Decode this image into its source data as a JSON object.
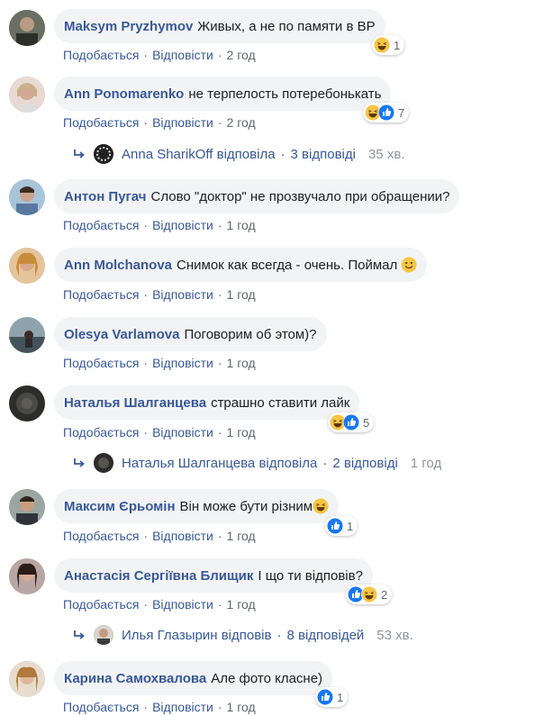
{
  "colors": {
    "link": "#385898",
    "meta": "#606770",
    "bubble": "#f2f3f5",
    "like_blue": "#1877f2",
    "haha_yellow": "#f7c444"
  },
  "comments": [
    {
      "author": "Maksym Pryzhymov",
      "text": "Живых, а не по памяти в ВР",
      "like": "Подобається",
      "reply": "Відповісти",
      "time": "2 год",
      "reactions": [
        "haha"
      ],
      "reaction_count": "1"
    },
    {
      "author": "Ann Ponomarenko",
      "text": "не терпелость потеребонькать",
      "like": "Подобається",
      "reply": "Відповісти",
      "time": "2 год",
      "reactions": [
        "haha",
        "like"
      ],
      "reaction_count": "7",
      "replies": {
        "name": "Anna SharikOff",
        "verb": "відповіла",
        "count": "3 відповіді",
        "time": "35 хв."
      }
    },
    {
      "author": "Антон Пугач",
      "text": "Слово \"доктор\" не прозвучало при обращении?",
      "like": "Подобається",
      "reply": "Відповісти",
      "time": "1 год"
    },
    {
      "author": "Ann Molchanova",
      "text": "Снимок как всегда - очень. Поймал",
      "like": "Подобається",
      "reply": "Відповісти",
      "time": "1 год",
      "inline_emoji": "smile-emoji"
    },
    {
      "author": "Olesya Varlamova",
      "text": "Поговорим об этом)?",
      "like": "Подобається",
      "reply": "Відповісти",
      "time": "1 год"
    },
    {
      "author": "Наталья Шалганцева",
      "text": "страшно ставити лайк",
      "like": "Подобається",
      "reply": "Відповісти",
      "time": "1 год",
      "reactions": [
        "haha",
        "like"
      ],
      "reaction_count": "5",
      "replies": {
        "name": "Наталья Шалганцева",
        "verb": "відповіла",
        "count": "2 відповіді",
        "time": "1 год"
      }
    },
    {
      "author": "Максим Єрьомін",
      "text": "Він може бути різним",
      "like": "Подобається",
      "reply": "Відповісти",
      "time": "1 год",
      "inline_emoji": "laugh-emoji",
      "reactions": [
        "like"
      ],
      "reaction_count": "1"
    },
    {
      "author": "Анастасія Сергіївна Блищик",
      "text": "І що ти відповів?",
      "like": "Подобається",
      "reply": "Відповісти",
      "time": "1 год",
      "reactions": [
        "like",
        "haha"
      ],
      "reaction_count": "2",
      "replies": {
        "name": "Илья Глазырин",
        "verb": "відповів",
        "count": "8 відповідей",
        "time": "53 хв."
      }
    },
    {
      "author": "Карина Самохвалова",
      "text": "Але фото класне)",
      "like": "Подобається",
      "reply": "Відповісти",
      "time": "1 год",
      "reactions": [
        "like"
      ],
      "reaction_count": "1"
    }
  ]
}
